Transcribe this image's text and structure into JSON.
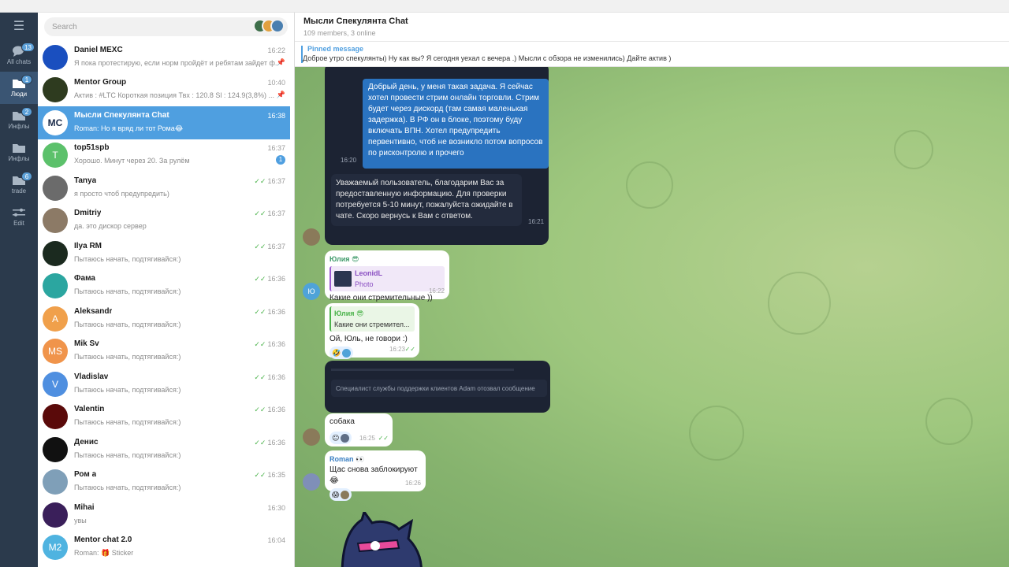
{
  "rail": {
    "folders": [
      {
        "label": "All chats",
        "badge": "13",
        "icon": "chats-icon",
        "active": false
      },
      {
        "label": "Люди",
        "badge": "1",
        "icon": "folder-icon",
        "active": true
      },
      {
        "label": "Инфлы",
        "badge": "2",
        "icon": "folder-icon",
        "active": false
      },
      {
        "label": "Инфлы",
        "badge": "",
        "icon": "folder-icon",
        "active": false
      },
      {
        "label": "trade",
        "badge": "6",
        "icon": "folder-icon",
        "active": false
      },
      {
        "label": "Edit",
        "badge": "",
        "icon": "sliders-icon",
        "active": false
      }
    ]
  },
  "search": {
    "placeholder": "Search"
  },
  "chats": [
    {
      "name": "Daniel MEXC",
      "time": "16:22",
      "preview": "Я пока протестирую, если норм пройдёт и ребятам зайдет ф...",
      "pinned": true,
      "avatar_color": "#1a4fbf",
      "initials": ""
    },
    {
      "name": "Mentor Group",
      "time": "10:40",
      "preview": "Актив : #LTC Короткая позиция  Твх : 120.8  Sl : 124.9(3,8%) ...",
      "pinned": true,
      "avatar_color": "#2e3b1f",
      "initials": ""
    },
    {
      "name": "Мысли Спекулянта Chat",
      "time": "16:38",
      "preview": "Roman: Но я вряд ли тот Рома😂",
      "active": true,
      "avatar_color": "#ffffff",
      "initials": "MC"
    },
    {
      "name": "top51spb",
      "time": "16:37",
      "preview": "Хорошо.  Минут через 20. За рулём",
      "badge": "1",
      "avatar_color": "#5cc16b",
      "initials": "T"
    },
    {
      "name": "Tanya",
      "time": "16:37",
      "preview": "я просто чтоб предупредить)",
      "read": true,
      "avatar_color": "#6b6b6b",
      "initials": ""
    },
    {
      "name": "Dmitriy",
      "time": "16:37",
      "preview": "да. это дискор сервер",
      "read": true,
      "avatar_color": "#8c7a66",
      "initials": ""
    },
    {
      "name": "Ilya RM",
      "time": "16:37",
      "preview": "Пытаюсь начать, подтягивайся:)",
      "read": true,
      "avatar_color": "#1b2a1f",
      "initials": ""
    },
    {
      "name": "Фама",
      "time": "16:36",
      "preview": "Пытаюсь начать, подтягивайся:)",
      "read": true,
      "avatar_color": "#2ba6a0",
      "initials": ""
    },
    {
      "name": "Aleksandr",
      "time": "16:36",
      "preview": "Пытаюсь начать, подтягивайся:)",
      "read": true,
      "avatar_color": "#f0a04b",
      "initials": "A"
    },
    {
      "name": "Mik Sv",
      "time": "16:36",
      "preview": "Пытаюсь начать, подтягивайся:)",
      "read": true,
      "avatar_color": "#f0944b",
      "initials": "MS"
    },
    {
      "name": "Vladislav",
      "time": "16:36",
      "preview": "Пытаюсь начать, подтягивайся:)",
      "read": true,
      "avatar_color": "#4f8fe0",
      "initials": "V"
    },
    {
      "name": "Valentin",
      "time": "16:36",
      "preview": "Пытаюсь начать, подтягивайся:)",
      "read": true,
      "avatar_color": "#5a0a0a",
      "initials": ""
    },
    {
      "name": "Денис",
      "time": "16:36",
      "preview": "Пытаюсь начать, подтягивайся:)",
      "read": true,
      "avatar_color": "#111111",
      "initials": ""
    },
    {
      "name": "Ром а",
      "time": "16:35",
      "preview": "Пытаюсь начать, подтягивайся:)",
      "read": true,
      "avatar_color": "#7f9fb8",
      "initials": ""
    },
    {
      "name": "Mihai",
      "time": "16:30",
      "preview": "увы",
      "avatar_color": "#3a1f5a",
      "initials": ""
    },
    {
      "name": "Mentor chat 2.0",
      "time": "16:04",
      "preview": "Roman: 🎁 Sticker",
      "group": true,
      "avatar_color": "#4fb3e0",
      "initials": "M2"
    }
  ],
  "chat": {
    "title": "Мысли Спекулянта Chat",
    "subtitle": "109 members, 3 online",
    "pinned_label": "Pinned message",
    "pinned_text": "Доброе утро спекулянты)    Ну как вы? Я сегодня уехал с вечера .) Мысли с обзора не изменились)    Дайте актив )"
  },
  "messages": {
    "m1_text": "Добрый день, у меня такая задача. Я сейчас хотел провести стрим онлайн торговли. Стрим будет через дискорд (там самая маленькая задержка). В РФ он в блоке, поэтому буду включать ВПН. Хотел предупредить первентивно, чтоб не возникло потом вопросов по рисконтролю и прочего",
    "m1_time": "16:20",
    "m2_text": "Уважаемый пользователь, благодарим Вас за предоставленную информацию. Для проверки потребуется 5-10 минут, пожалуйста ожидайте в чате. Скоро вернусь к Вам с ответом.",
    "m2_time": "16:21",
    "m3_sender": "Юлия 😎",
    "m3_reply_name": "LeonidL",
    "m3_reply_text": "Photo",
    "m3_text": "Какие они стремительные ))",
    "m3_time": "16:22",
    "m3_avatar": "Ю",
    "m4_reply_name": "Юлия 😎",
    "m4_reply_text": "Какие они стремител...",
    "m4_text": "Ой, Юль, не говори :)",
    "m4_react": "🤣",
    "m4_time": "16:23",
    "m5_text": "Специалист службы поддержки клиентов Adam отозвал сообщение",
    "m6_text": "собака",
    "m6_react": "😐",
    "m6_time": "16:25",
    "m7_sender": "Roman 👀",
    "m7_text": "Щас снова заблокируют😂",
    "m7_react": "😱",
    "m7_time": "16:26"
  }
}
